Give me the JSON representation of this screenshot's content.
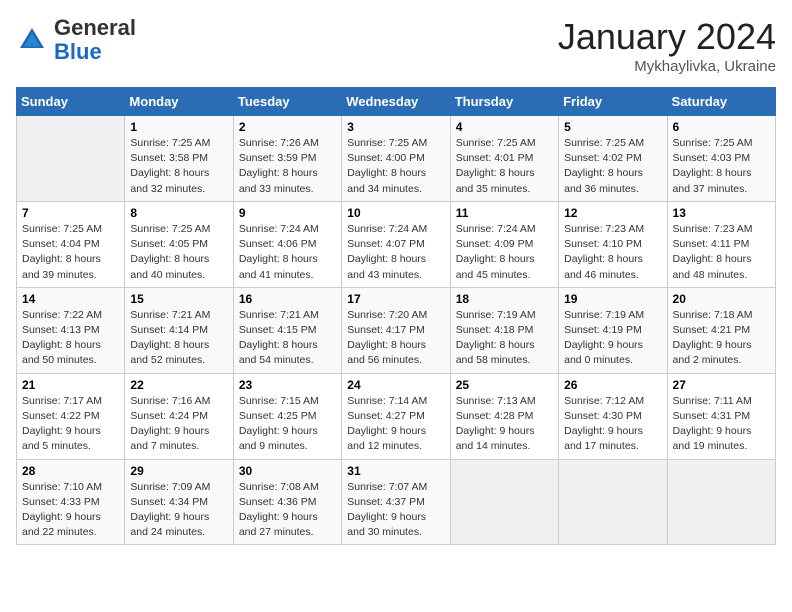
{
  "header": {
    "logo_general": "General",
    "logo_blue": "Blue",
    "month_title": "January 2024",
    "location": "Mykhaylivka, Ukraine"
  },
  "weekdays": [
    "Sunday",
    "Monday",
    "Tuesday",
    "Wednesday",
    "Thursday",
    "Friday",
    "Saturday"
  ],
  "weeks": [
    [
      {
        "day": "",
        "empty": true
      },
      {
        "day": "1",
        "sunrise": "7:25 AM",
        "sunset": "3:58 PM",
        "daylight": "8 hours and 32 minutes."
      },
      {
        "day": "2",
        "sunrise": "7:26 AM",
        "sunset": "3:59 PM",
        "daylight": "8 hours and 33 minutes."
      },
      {
        "day": "3",
        "sunrise": "7:25 AM",
        "sunset": "4:00 PM",
        "daylight": "8 hours and 34 minutes."
      },
      {
        "day": "4",
        "sunrise": "7:25 AM",
        "sunset": "4:01 PM",
        "daylight": "8 hours and 35 minutes."
      },
      {
        "day": "5",
        "sunrise": "7:25 AM",
        "sunset": "4:02 PM",
        "daylight": "8 hours and 36 minutes."
      },
      {
        "day": "6",
        "sunrise": "7:25 AM",
        "sunset": "4:03 PM",
        "daylight": "8 hours and 37 minutes."
      }
    ],
    [
      {
        "day": "7",
        "sunrise": "7:25 AM",
        "sunset": "4:04 PM",
        "daylight": "8 hours and 39 minutes."
      },
      {
        "day": "8",
        "sunrise": "7:25 AM",
        "sunset": "4:05 PM",
        "daylight": "8 hours and 40 minutes."
      },
      {
        "day": "9",
        "sunrise": "7:24 AM",
        "sunset": "4:06 PM",
        "daylight": "8 hours and 41 minutes."
      },
      {
        "day": "10",
        "sunrise": "7:24 AM",
        "sunset": "4:07 PM",
        "daylight": "8 hours and 43 minutes."
      },
      {
        "day": "11",
        "sunrise": "7:24 AM",
        "sunset": "4:09 PM",
        "daylight": "8 hours and 45 minutes."
      },
      {
        "day": "12",
        "sunrise": "7:23 AM",
        "sunset": "4:10 PM",
        "daylight": "8 hours and 46 minutes."
      },
      {
        "day": "13",
        "sunrise": "7:23 AM",
        "sunset": "4:11 PM",
        "daylight": "8 hours and 48 minutes."
      }
    ],
    [
      {
        "day": "14",
        "sunrise": "7:22 AM",
        "sunset": "4:13 PM",
        "daylight": "8 hours and 50 minutes."
      },
      {
        "day": "15",
        "sunrise": "7:21 AM",
        "sunset": "4:14 PM",
        "daylight": "8 hours and 52 minutes."
      },
      {
        "day": "16",
        "sunrise": "7:21 AM",
        "sunset": "4:15 PM",
        "daylight": "8 hours and 54 minutes."
      },
      {
        "day": "17",
        "sunrise": "7:20 AM",
        "sunset": "4:17 PM",
        "daylight": "8 hours and 56 minutes."
      },
      {
        "day": "18",
        "sunrise": "7:19 AM",
        "sunset": "4:18 PM",
        "daylight": "8 hours and 58 minutes."
      },
      {
        "day": "19",
        "sunrise": "7:19 AM",
        "sunset": "4:19 PM",
        "daylight": "9 hours and 0 minutes."
      },
      {
        "day": "20",
        "sunrise": "7:18 AM",
        "sunset": "4:21 PM",
        "daylight": "9 hours and 2 minutes."
      }
    ],
    [
      {
        "day": "21",
        "sunrise": "7:17 AM",
        "sunset": "4:22 PM",
        "daylight": "9 hours and 5 minutes."
      },
      {
        "day": "22",
        "sunrise": "7:16 AM",
        "sunset": "4:24 PM",
        "daylight": "9 hours and 7 minutes."
      },
      {
        "day": "23",
        "sunrise": "7:15 AM",
        "sunset": "4:25 PM",
        "daylight": "9 hours and 9 minutes."
      },
      {
        "day": "24",
        "sunrise": "7:14 AM",
        "sunset": "4:27 PM",
        "daylight": "9 hours and 12 minutes."
      },
      {
        "day": "25",
        "sunrise": "7:13 AM",
        "sunset": "4:28 PM",
        "daylight": "9 hours and 14 minutes."
      },
      {
        "day": "26",
        "sunrise": "7:12 AM",
        "sunset": "4:30 PM",
        "daylight": "9 hours and 17 minutes."
      },
      {
        "day": "27",
        "sunrise": "7:11 AM",
        "sunset": "4:31 PM",
        "daylight": "9 hours and 19 minutes."
      }
    ],
    [
      {
        "day": "28",
        "sunrise": "7:10 AM",
        "sunset": "4:33 PM",
        "daylight": "9 hours and 22 minutes."
      },
      {
        "day": "29",
        "sunrise": "7:09 AM",
        "sunset": "4:34 PM",
        "daylight": "9 hours and 24 minutes."
      },
      {
        "day": "30",
        "sunrise": "7:08 AM",
        "sunset": "4:36 PM",
        "daylight": "9 hours and 27 minutes."
      },
      {
        "day": "31",
        "sunrise": "7:07 AM",
        "sunset": "4:37 PM",
        "daylight": "9 hours and 30 minutes."
      },
      {
        "day": "",
        "empty": true
      },
      {
        "day": "",
        "empty": true
      },
      {
        "day": "",
        "empty": true
      }
    ]
  ],
  "labels": {
    "sunrise_prefix": "Sunrise: ",
    "sunset_prefix": "Sunset: ",
    "daylight_prefix": "Daylight: "
  }
}
